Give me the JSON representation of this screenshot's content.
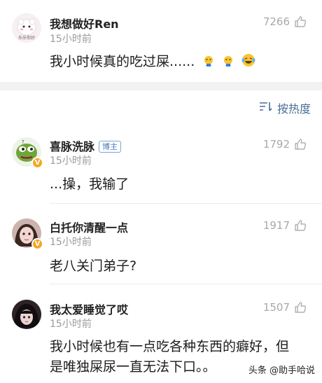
{
  "comments": [
    {
      "username": "我想做好Ren",
      "time": "15小时前",
      "likes": "7266",
      "text": "我小时候真的吃过屎......",
      "avatar_tag": "乐乐你好",
      "emojis": [
        "crying-face-icon",
        "crying-face-icon",
        "laughing-tears-icon"
      ]
    },
    {
      "username": "喜脉洗脉",
      "badge": "博主",
      "time": "15小时前",
      "likes": "1792",
      "text": "...操，我输了",
      "verified": "V"
    },
    {
      "username": "白托你清醒一点",
      "time": "15小时前",
      "likes": "1917",
      "text": "老八关门弟子?",
      "verified": "V"
    },
    {
      "username": "我太爱睡觉了哎",
      "time": "15小时前",
      "likes": "1507",
      "text": "我小时候也有一点吃各种东西的癖好，但是唯独屎尿一直无法下口。。"
    }
  ],
  "sort": {
    "label": "按热度",
    "icon": "sort-icon"
  },
  "watermark": {
    "text": "头条 @助手哈说"
  },
  "colors": {
    "accent": "#4a6e9a",
    "badge": "#f5a623",
    "muted": "#9a9a9a"
  }
}
